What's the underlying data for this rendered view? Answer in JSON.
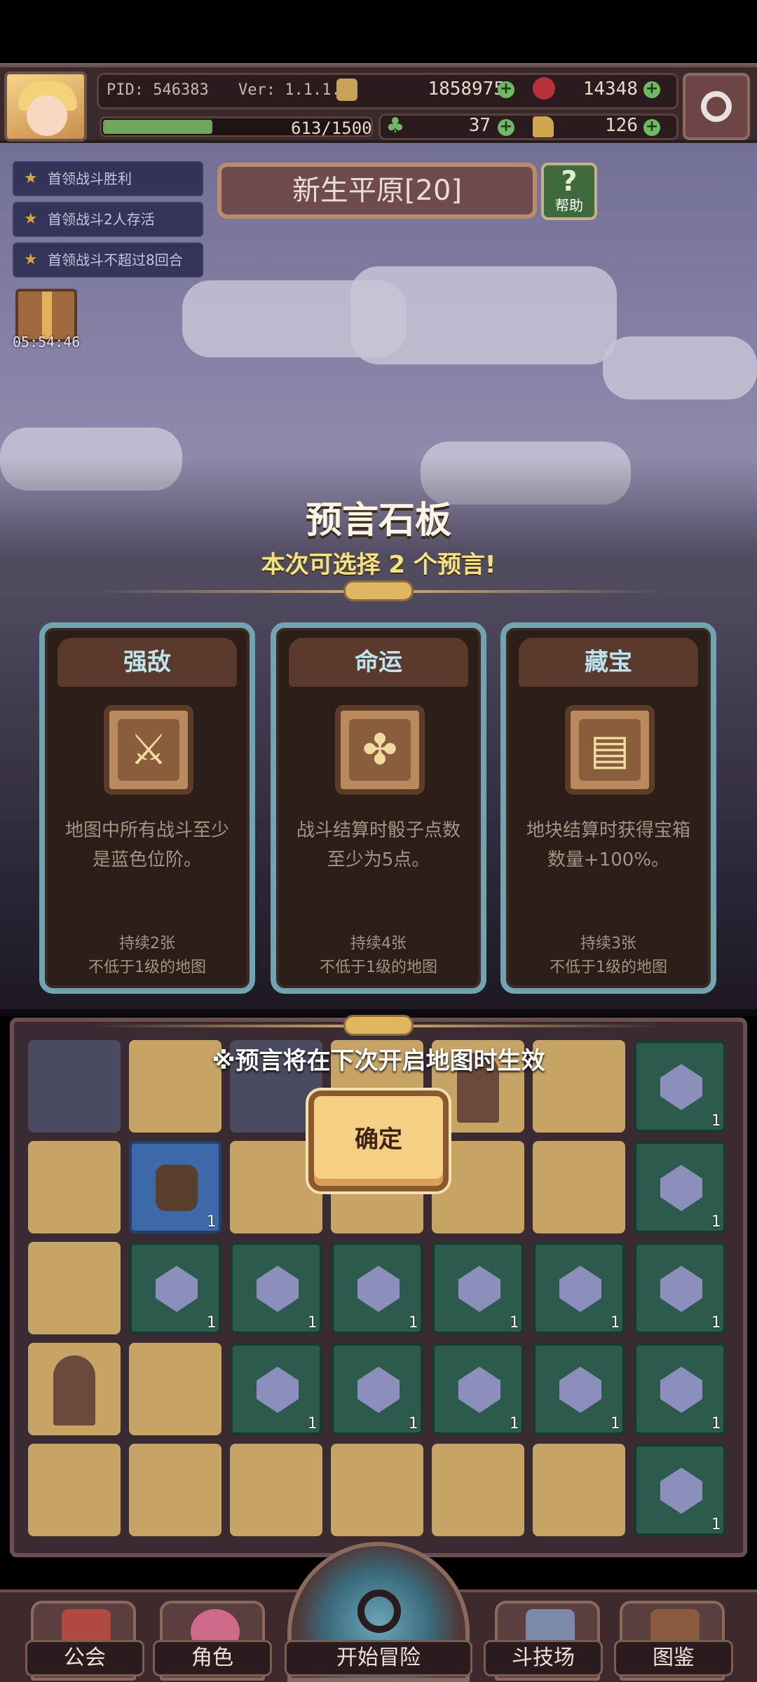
{
  "player": {
    "pid": "PID: 546383",
    "version": "Ver: 1.1.1.5",
    "gold": "1858975",
    "gems": "14348",
    "xp_text": "613/1500",
    "xp_progress": 0.41,
    "clover": "37",
    "boots": "126"
  },
  "quests": [
    {
      "label": "首领战斗胜利"
    },
    {
      "label": "首领战斗2人存活"
    },
    {
      "label": "首领战斗不超过8回合"
    }
  ],
  "map": {
    "title": "新生平原[20]",
    "help_label": "帮助",
    "help_icon": "?",
    "chest_timer": "05:54:46"
  },
  "modal": {
    "title": "预言石板",
    "subtitle": "本次可选择 2 个预言!",
    "notice": "※预言将在下次开启地图时生效",
    "confirm_label": "确定",
    "cards": [
      {
        "name": "强敌",
        "icon": "crossed-swords-icon",
        "glyph": "⚔",
        "desc1": "地图中所有战斗至少",
        "desc2": "是蓝色位阶。",
        "duration": "持续2张",
        "level": "不低于1级的地图"
      },
      {
        "name": "命运",
        "icon": "clover-icon",
        "glyph": "✤",
        "desc1": "战斗结算时骰子点数",
        "desc2": "至少为5点。",
        "duration": "持续4张",
        "level": "不低于1级的地图"
      },
      {
        "name": "藏宝",
        "icon": "scroll-icon",
        "glyph": "▤",
        "desc1": "地块结算时获得宝箱",
        "desc2": "数量+100%。",
        "duration": "持续3张",
        "level": "不低于1级的地图"
      }
    ]
  },
  "tile_count": "1",
  "nav": [
    {
      "label": "公会"
    },
    {
      "label": "角色"
    },
    {
      "label": "开始冒险"
    },
    {
      "label": "斗技场"
    },
    {
      "label": "图鉴"
    }
  ],
  "colors": {
    "accent_gold": "#f6e27a",
    "card_border": "#6fa4b0",
    "card_title": "#bde4ee",
    "confirm_bg": "#f5cf84"
  }
}
